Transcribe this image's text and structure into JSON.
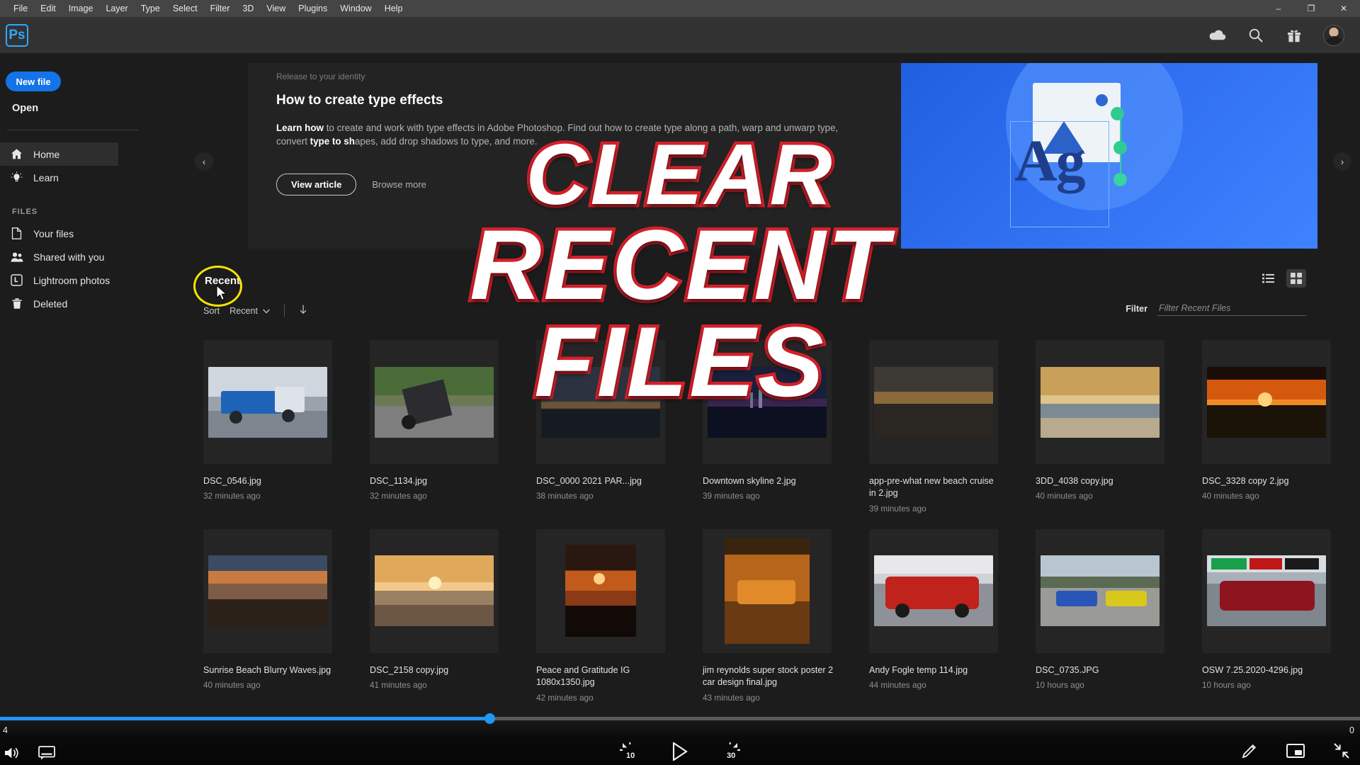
{
  "menubar": {
    "items": [
      "File",
      "Edit",
      "Image",
      "Layer",
      "Type",
      "Select",
      "Filter",
      "3D",
      "View",
      "Plugins",
      "Window",
      "Help"
    ],
    "window_controls": {
      "minimize": "–",
      "maximize": "❐",
      "close": "✕"
    }
  },
  "header": {
    "logo": "Ps",
    "icons": [
      "cloud-icon",
      "search-icon",
      "gift-icon",
      "avatar"
    ]
  },
  "sidebar": {
    "new_file_label": "New file",
    "open_label": "Open",
    "items": [
      {
        "label": "Home",
        "icon": "home-icon",
        "active": true
      },
      {
        "label": "Learn",
        "icon": "lightbulb-icon",
        "active": false
      }
    ],
    "files_group_label": "FILES",
    "file_items": [
      {
        "label": "Your files",
        "icon": "document-icon"
      },
      {
        "label": "Shared with you",
        "icon": "people-icon"
      },
      {
        "label": "Lightroom photos",
        "icon": "lightroom-icon"
      },
      {
        "label": "Deleted",
        "icon": "trash-icon"
      }
    ]
  },
  "banner": {
    "eyebrow": "Release to your identity",
    "title": "How to create type effects",
    "desc_bold": "Learn how",
    "desc_rest": " to create and work with type effects in Adobe Photoshop. Find out how to create type along a path, warp and unwarp type, convert ",
    "desc_bold2": "type to sh",
    "desc_rest2": "apes, add drop shadows to type, and more.",
    "view_article_label": "View article",
    "browse_more_label": "Browse more",
    "prev_arrow": "‹",
    "next_arrow": "›",
    "art_letters": "Ag"
  },
  "recent_section": {
    "tab_label": "Recent",
    "sort_label": "Sort",
    "sort_value": "Recent",
    "sort_caret": "⌄",
    "sort_direction_icon": "arrow-down-icon",
    "filter_label": "Filter",
    "filter_placeholder": "Filter Recent Files",
    "filter_value": "",
    "view_list_icon": "list-view-icon",
    "view_grid_icon": "grid-view-icon"
  },
  "files": [
    {
      "name": "DSC_0546.jpg",
      "time": "32 minutes ago",
      "thumb": "truck"
    },
    {
      "name": "DSC_1134.jpg",
      "time": "32 minutes ago",
      "thumb": "sprintcar"
    },
    {
      "name": "DSC_0000 2021 PAR...jpg",
      "time": "38 minutes ago",
      "thumb": "dusk"
    },
    {
      "name": "Downtown skyline 2.jpg",
      "time": "39 minutes ago",
      "thumb": "city"
    },
    {
      "name": "app-pre-what new beach cruise in 2.jpg",
      "time": "39 minutes ago",
      "thumb": "shore"
    },
    {
      "name": "3DD_4038 copy.jpg",
      "time": "40 minutes ago",
      "thumb": "beach"
    },
    {
      "name": "DSC_3328 copy 2.jpg",
      "time": "40 minutes ago",
      "thumb": "sunset"
    },
    {
      "name": "Sunrise Beach Blurry Waves.jpg",
      "time": "40 minutes ago",
      "thumb": "waves"
    },
    {
      "name": "DSC_2158 copy.jpg",
      "time": "41 minutes ago",
      "thumb": "goldensea"
    },
    {
      "name": "Peace and Gratitude IG 1080x1350.jpg",
      "time": "42 minutes ago",
      "thumb": "pier"
    },
    {
      "name": "jim reynolds super stock poster 2 car design final.jpg",
      "time": "43 minutes ago",
      "thumb": "poster"
    },
    {
      "name": "Andy Fogle temp 114.jpg",
      "time": "44 minutes ago",
      "thumb": "redcar"
    },
    {
      "name": "DSC_0735.JPG",
      "time": "10 hours ago",
      "thumb": "dragstrip"
    },
    {
      "name": "OSW 7.25.2020-4296.jpg",
      "time": "10 hours ago",
      "thumb": "energycar"
    }
  ],
  "overlay": {
    "line1": "CLEAR",
    "line2": "RECENT",
    "line3": "FILES",
    "fill_color": "#ffffff",
    "stroke_color": "#d8202a",
    "highlight_ring_color": "#f5e400"
  },
  "player": {
    "time_elapsed": "4",
    "time_remaining": "0",
    "progress_percent": 36,
    "accent_color": "#2196f3",
    "rewind_label": "10",
    "forward_label": "30",
    "controls": [
      "volume-icon",
      "captions-icon",
      "rewind-10-icon",
      "play-icon",
      "forward-30-icon",
      "pencil-icon",
      "picture-in-picture-icon",
      "exit-fullscreen-icon"
    ]
  }
}
